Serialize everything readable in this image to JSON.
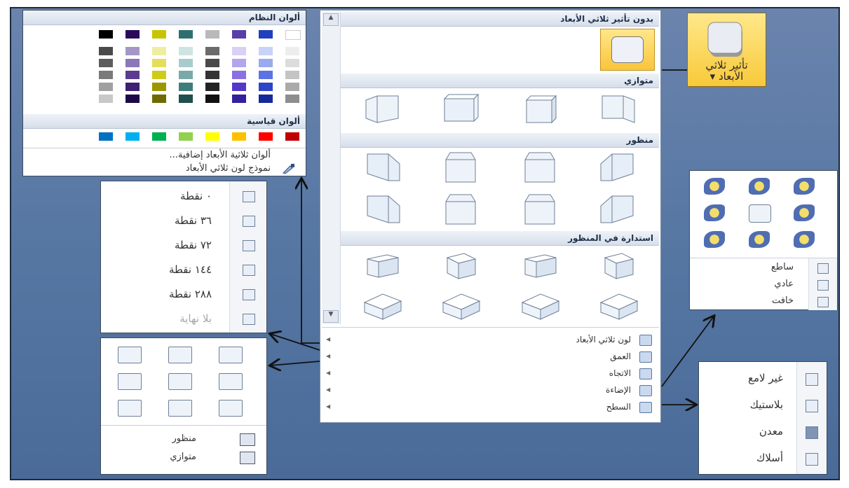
{
  "ribbon_button": {
    "label_line1": "تأثير ثلاثي",
    "label_line2": "الأبعاد",
    "dropdown_glyph": "▾"
  },
  "gallery": {
    "none_header": "بدون تأثير ثلاثي الأبعاد",
    "parallel_header": "متوازي",
    "perspective_header": "منظور",
    "rotation_header": "استدارة في المنظور",
    "menu": [
      "لون ثلاثي الأبعاد",
      "العمق",
      "الاتجاه",
      "الإضاءة",
      "السطح"
    ],
    "menu_icons": [
      "paint-bucket-icon",
      "depth-icon",
      "direction-icon",
      "lighting-icon",
      "surface-icon"
    ]
  },
  "colors_panel": {
    "system_header": "ألوان النظام",
    "standard_header": "ألوان قياسية",
    "more_label": "ألوان ثلاثية الأبعاد إضافية...",
    "picker_label": "نموذج لون ثلاثي الأبعاد",
    "system_columns": [
      [
        "#000000",
        "#4a4a4a",
        "#5d5d5d",
        "#7a7a7a",
        "#a0a0a0",
        "#c8c8c8"
      ],
      [
        "#2b0a5a",
        "#a497c8",
        "#8a78b8",
        "#5b3c8f",
        "#3d1f73",
        "#1e0848"
      ],
      [
        "#c9c400",
        "#efeea0",
        "#e3df5c",
        "#cfcb1a",
        "#9c9600",
        "#6f6a00"
      ],
      [
        "#2f6f6f",
        "#cfe3e3",
        "#a8cccc",
        "#7aa9a9",
        "#3f7c7c",
        "#1f4f4f"
      ],
      [
        "#b9b9b9",
        "#6b6b6b",
        "#4a4a4a",
        "#333333",
        "#222222",
        "#111111"
      ],
      [
        "#5a3da8",
        "#d9d0f5",
        "#b4a5ee",
        "#8a70e2",
        "#5537c7",
        "#33209a"
      ],
      [
        "#1e3fbf",
        "#c9d2f7",
        "#9aaaf0",
        "#5b73e3",
        "#2d44c8",
        "#142a9a"
      ],
      [
        "#ffffff",
        "#ededed",
        "#dcdcdc",
        "#c4c4c4",
        "#aaaaaa",
        "#8e8e8e"
      ]
    ],
    "standard_colors": [
      "#c00000",
      "#ff0000",
      "#ffc000",
      "#ffff00",
      "#92d050",
      "#00b050",
      "#00b0f0",
      "#0070c0"
    ]
  },
  "depth_panel": {
    "items": [
      "٠ نقطة",
      "٣٦ نقطة",
      "٧٢ نقطة",
      "١٤٤ نقطة",
      "٢٨٨ نقطة",
      "بلا نهاية"
    ]
  },
  "direction_panel": {
    "items": [
      "منظور",
      "متوازي"
    ]
  },
  "lighting_panel": {
    "items": [
      "ساطع",
      "عادي",
      "خافت"
    ]
  },
  "surface_panel": {
    "items": [
      "غير لامع",
      "بلاستيك",
      "معدن",
      "أسلاك"
    ]
  }
}
